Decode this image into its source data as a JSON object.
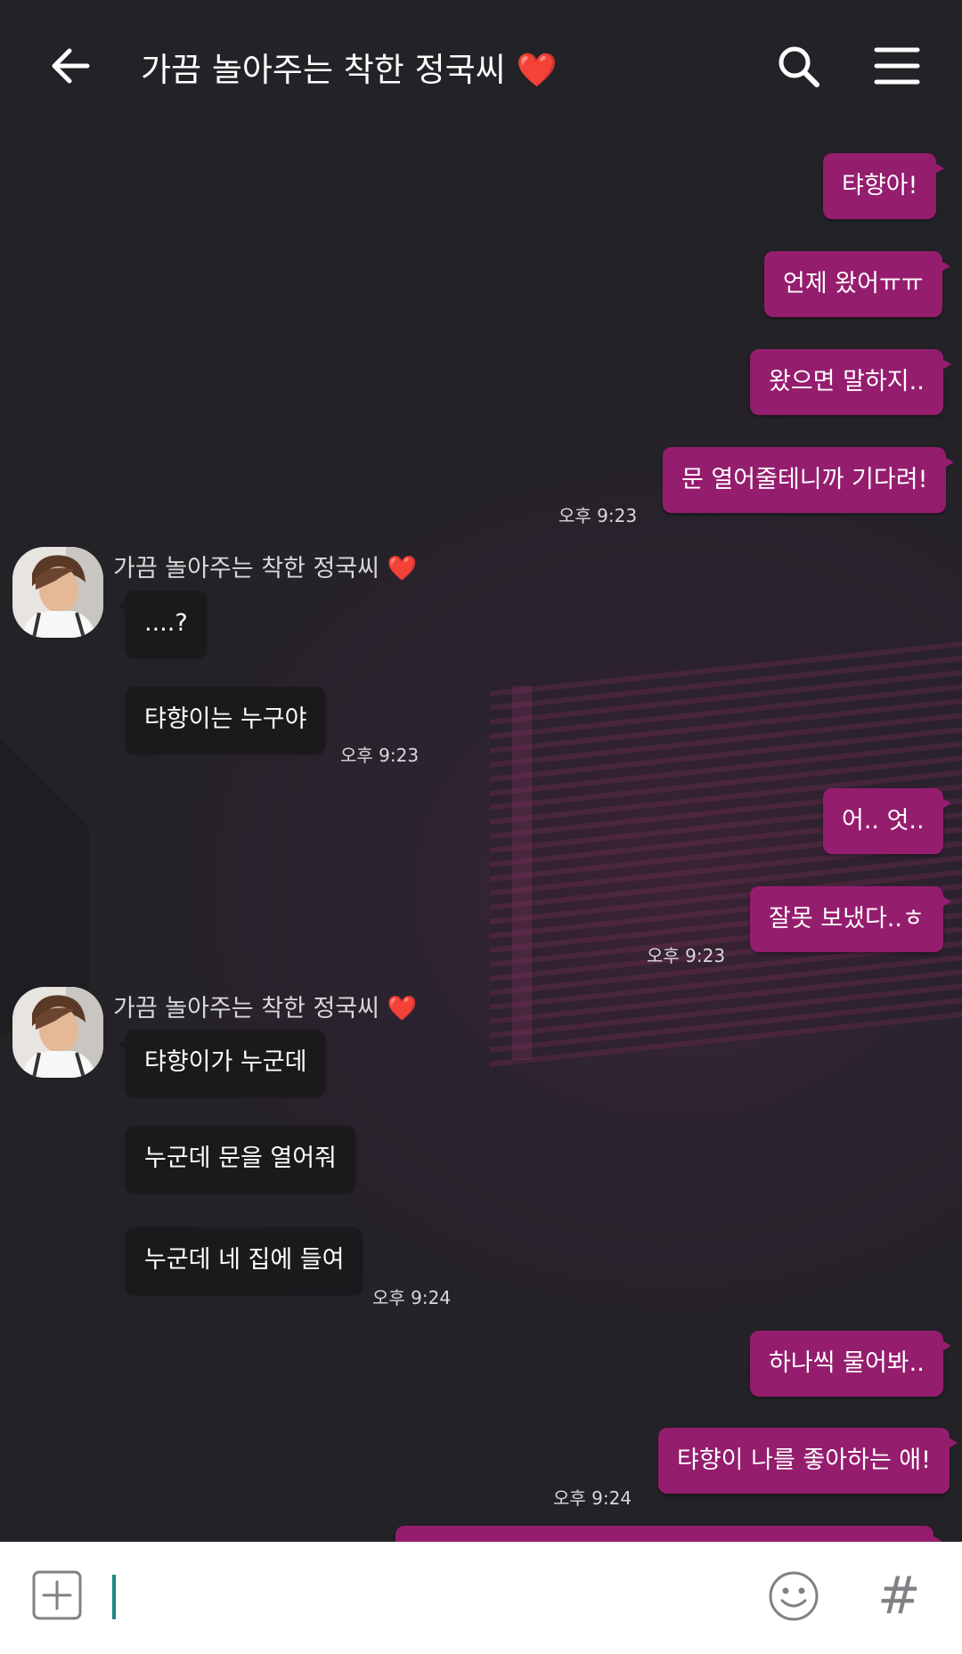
{
  "header": {
    "title": "가끔 놀아주는 착한 정국씨 ❤️"
  },
  "messages": [
    {
      "from": "me",
      "text": "탸향아!"
    },
    {
      "from": "me",
      "text": "언제 왔어ㅠㅠ"
    },
    {
      "from": "me",
      "text": "왔으면 말하지.."
    },
    {
      "from": "me",
      "text": "문 열어줄테니까 기다려!",
      "time": "오후 9:23"
    },
    {
      "from": "them",
      "sender": "가끔 놀아주는 착한 정국씨 ❤️",
      "text": "....?"
    },
    {
      "from": "them",
      "text": "탸향이는 누구야",
      "time": "오후 9:23"
    },
    {
      "from": "me",
      "text": "어.. 엇.."
    },
    {
      "from": "me",
      "text": "잘못 보냈다..ㅎ",
      "time": "오후 9:23"
    },
    {
      "from": "them",
      "sender": "가끔 놀아주는 착한 정국씨 ❤️",
      "text": "탸향이가 누군데"
    },
    {
      "from": "them",
      "text": "누군데 문을 열어줘"
    },
    {
      "from": "them",
      "text": "누군데 네 집에 들여",
      "time": "오후 9:24"
    },
    {
      "from": "me",
      "text": "하나씩 물어봐.."
    },
    {
      "from": "me",
      "text": "탸향이 나를 좋아하는 애!",
      "time": "오후 9:24"
    }
  ],
  "input": {
    "value": ""
  },
  "icons": {
    "back": "arrow-left-icon",
    "search": "search-icon",
    "menu": "hamburger-menu-icon",
    "attach": "plus-square-icon",
    "emoji": "smiley-icon",
    "hashtag": "#"
  },
  "colors": {
    "my_bubble": "#951d6e",
    "their_bubble": "#1a191c",
    "background": "#252326",
    "cursor": "#1a8a7f"
  }
}
